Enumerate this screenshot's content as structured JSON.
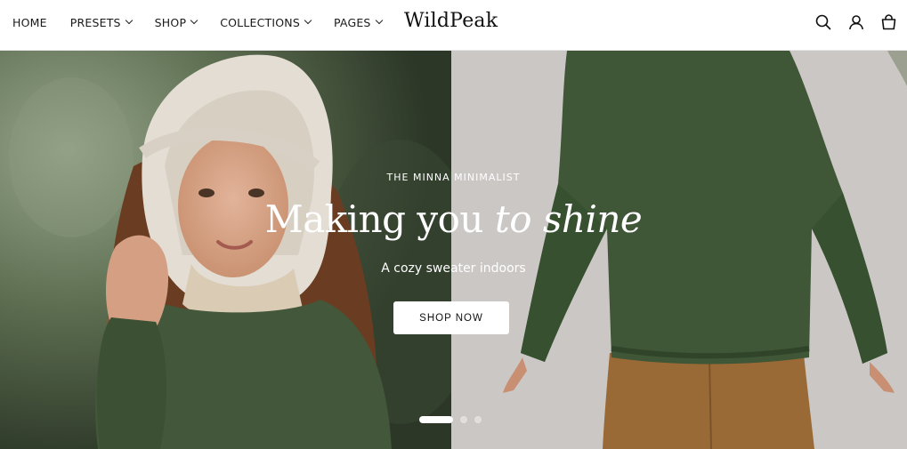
{
  "header": {
    "logo": "WildPeak",
    "nav": [
      {
        "label": "HOME",
        "has_dropdown": false
      },
      {
        "label": "PRESETS",
        "has_dropdown": true
      },
      {
        "label": "SHOP",
        "has_dropdown": true
      },
      {
        "label": "COLLECTIONS",
        "has_dropdown": true
      },
      {
        "label": "PAGES",
        "has_dropdown": true
      }
    ],
    "icons": [
      "search-icon",
      "account-icon",
      "cart-icon"
    ]
  },
  "hero": {
    "eyebrow": "THE MINNA MINIMALIST",
    "headline_regular": "Making you ",
    "headline_italic": "to shine",
    "subline": "A cozy sweater indoors",
    "cta_label": "SHOP NOW",
    "slides_total": 3,
    "slide_active": 1
  },
  "colors": {
    "text_dark": "#111111",
    "hero_text": "#ffffff",
    "sweater_green": "#3f5637",
    "pants_brown": "#9a6a36",
    "backdrop_grey": "#cfcccb"
  }
}
